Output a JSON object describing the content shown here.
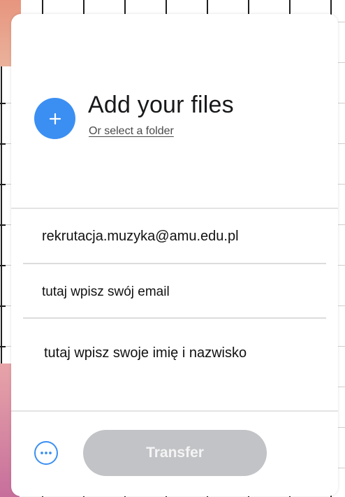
{
  "upload": {
    "title": "Add your files",
    "folder_link": "Or select a folder",
    "add_icon": "plus-icon"
  },
  "form": {
    "to_value": "rekrutacja.muzyka@amu.edu.pl",
    "email_value": "tutaj wpisz swój email",
    "name_value": "tutaj wpisz swoje imię i nazwisko"
  },
  "footer": {
    "more_icon": "more-options-icon",
    "transfer_label": "Transfer",
    "transfer_state": "disabled"
  },
  "colors": {
    "accent": "#3b8ff2",
    "button_disabled": "#c2c3c6",
    "title_text": "#17181a"
  }
}
